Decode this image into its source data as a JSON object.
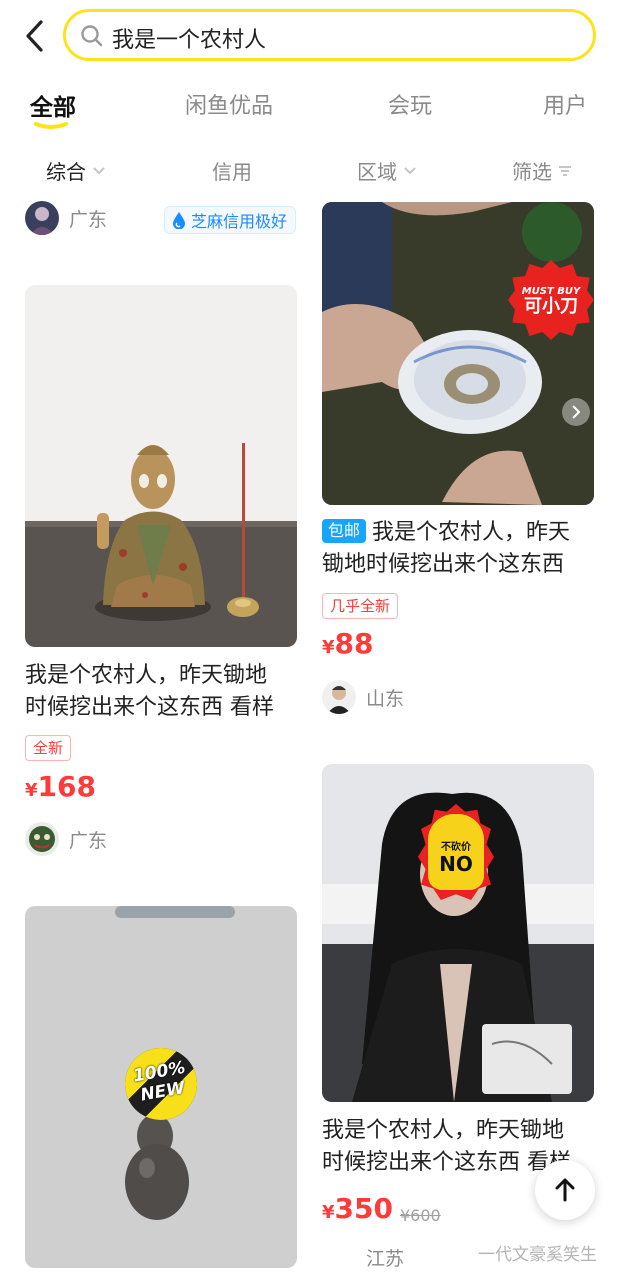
{
  "search": {
    "query": "我是一个农村人"
  },
  "tabs": [
    {
      "label": "全部",
      "active": true
    },
    {
      "label": "闲鱼优品",
      "active": false
    },
    {
      "label": "会玩",
      "active": false
    },
    {
      "label": "用户",
      "active": false
    }
  ],
  "filters": [
    {
      "label": "综合",
      "icon": "chevron-down-icon"
    },
    {
      "label": "信用"
    },
    {
      "label": "区域",
      "icon": "chevron-down-icon"
    },
    {
      "label": "筛选",
      "icon": "filter-icon"
    }
  ],
  "colors": {
    "accent": "#ffe219",
    "price": "#ff3a3a",
    "zhima": "#1a8cff",
    "baoyou": "#16a6ff"
  },
  "items": [
    {
      "seller_region": "广东",
      "credit_badge": "芝麻信用极好"
    },
    {
      "title_line1": "我是个农村人，昨天锄地",
      "title_line2": "时候挖出来个这东西 看样",
      "tag": "全新",
      "currency": "¥",
      "price": "168",
      "seller_region": "广东"
    },
    {
      "image_badge_line1": "MUST BUY",
      "image_badge_line2": "可小刀",
      "shipping_badge": "包邮",
      "title_line1": "我是个农村人，昨天",
      "title_line2": "锄地时候挖出来个这东西",
      "tag": "几乎全新",
      "currency": "¥",
      "price": "88",
      "seller_region": "山东"
    },
    {
      "image_badge_line1": "不砍价",
      "image_badge_line2": "NO",
      "title_line1": "我是个农村人，昨天锄地",
      "title_line2": "时候挖出来个这东西 看样",
      "currency": "¥",
      "price": "350",
      "original_price": "¥600",
      "seller_region": "江苏"
    },
    {
      "image_badge_line1": "100%",
      "image_badge_line2": "NEW"
    }
  ],
  "watermark": "一代文豪奚笑生"
}
